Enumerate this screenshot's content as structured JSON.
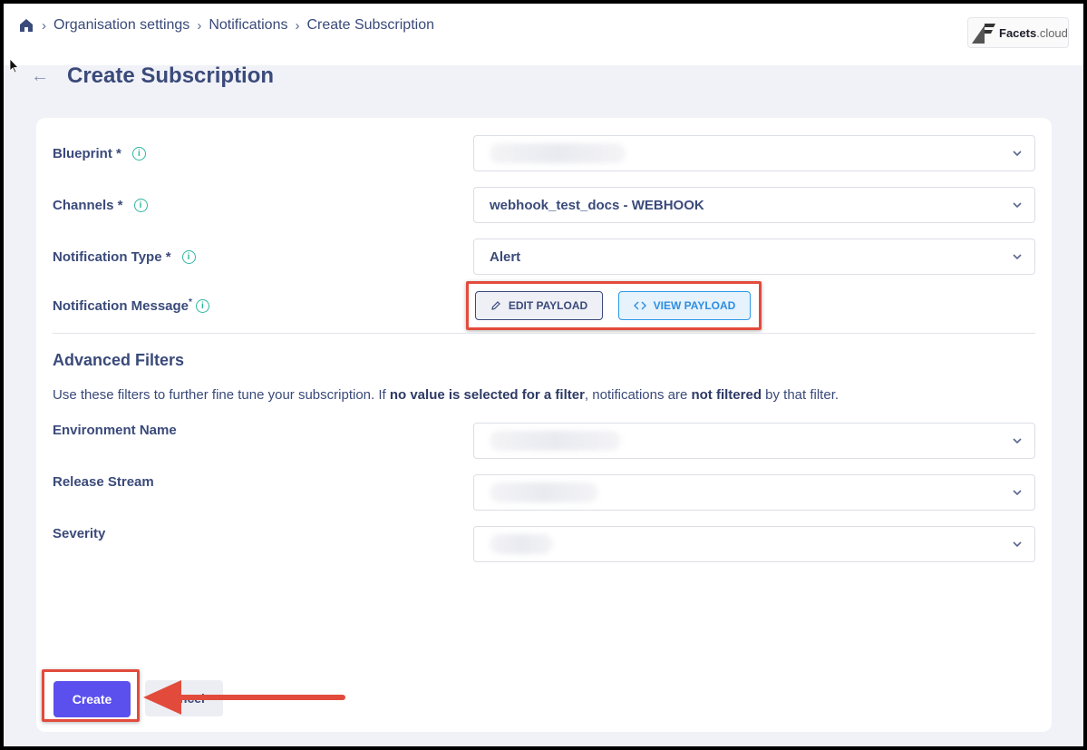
{
  "breadcrumb": {
    "items": [
      "Organisation settings",
      "Notifications",
      "Create Subscription"
    ]
  },
  "logo": {
    "bold": "Facets",
    "light": ".cloud"
  },
  "page": {
    "title": "Create Subscription"
  },
  "form": {
    "blueprint": {
      "label": "Blueprint *",
      "value": ""
    },
    "channels": {
      "label": "Channels *",
      "value": "webhook_test_docs - WEBHOOK"
    },
    "notification_type": {
      "label": "Notification Type *",
      "value": "Alert"
    },
    "notification_message": {
      "label": "Notification Message",
      "required_mark": "*",
      "edit_label": "EDIT PAYLOAD",
      "view_label": "VIEW PAYLOAD"
    }
  },
  "advanced": {
    "title": "Advanced Filters",
    "desc_1": "Use these filters to further fine tune your subscription. If ",
    "desc_bold_1": "no value is selected for a filter",
    "desc_2": ", notifications are ",
    "desc_bold_2": "not filtered",
    "desc_3": " by that filter.",
    "environment": {
      "label": "Environment Name"
    },
    "release_stream": {
      "label": "Release Stream"
    },
    "severity": {
      "label": "Severity"
    }
  },
  "actions": {
    "create_label": "Create",
    "cancel_label": "Cancel"
  },
  "colors": {
    "accent": "#5b50ee",
    "annotation": "#e24b3c",
    "text": "#3a4a7a",
    "info": "#2fb6a0"
  }
}
